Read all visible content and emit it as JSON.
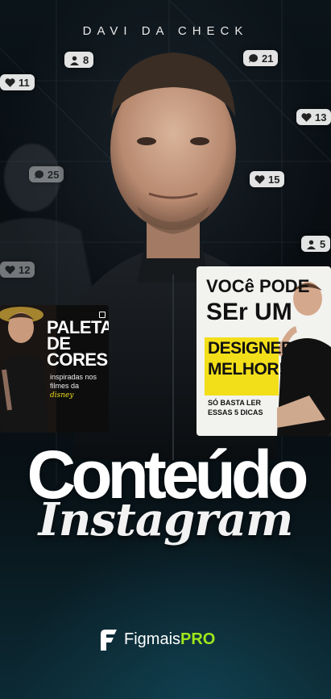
{
  "header": {
    "brand": "DAVI DA CHECK"
  },
  "notifications": [
    {
      "count": "8"
    },
    {
      "count": "21"
    },
    {
      "count": "11"
    },
    {
      "count": "13"
    },
    {
      "count": "15"
    },
    {
      "count": "5"
    },
    {
      "count": "25"
    },
    {
      "count": "12"
    }
  ],
  "card_left": {
    "title_line1": "PALETAS",
    "title_line2": "DE CORES",
    "sub_line1": "inspiradas nos",
    "sub_line2": "filmes da",
    "sub_script": "disney"
  },
  "card_right": {
    "line1": "VOCê PODE",
    "line2": "SEr UM",
    "highlight1": "DESIGNER",
    "highlight2": "MELHOR!",
    "small1": "SÓ BASTA LER",
    "small2": "ESSAS 5 DICAS"
  },
  "headline": {
    "line1": "Conteúdo",
    "line2": "Instagram"
  },
  "logo": {
    "name": "Figmais",
    "pro": "PRO"
  },
  "colors": {
    "accent": "#9fe61b",
    "highlight": "#f2df1a",
    "background": "#070b0f"
  }
}
